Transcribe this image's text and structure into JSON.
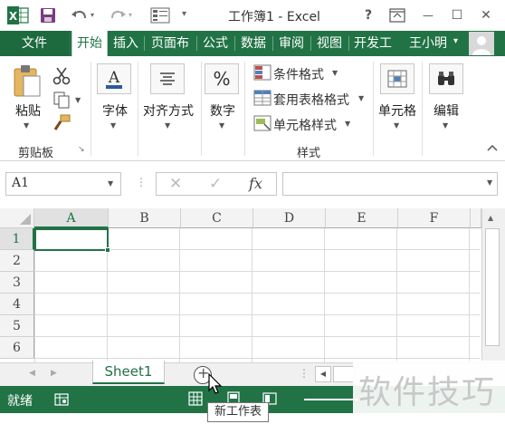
{
  "window": {
    "title": "工作簿1 - Excel",
    "controls": {
      "help": "?",
      "minimize": "—",
      "restore": "☐",
      "close": "✕",
      "ribbon_display": "⬒"
    }
  },
  "quick_access": {
    "save": "save-icon",
    "undo": "undo-icon",
    "redo": "redo-icon",
    "form": "form-icon",
    "customize": "▾"
  },
  "tabs": [
    {
      "label": "文件"
    },
    {
      "label": "开始"
    },
    {
      "label": "插入"
    },
    {
      "label": "页面布"
    },
    {
      "label": "公式"
    },
    {
      "label": "数据"
    },
    {
      "label": "审阅"
    },
    {
      "label": "视图"
    },
    {
      "label": "开发工"
    }
  ],
  "user": {
    "name": "王小明",
    "caret": "▾"
  },
  "ribbon": {
    "clipboard": {
      "paste": "粘贴",
      "group": "剪贴板"
    },
    "font": {
      "label": "字体"
    },
    "alignment": {
      "label": "对齐方式"
    },
    "number": {
      "label": "数字",
      "symbol": "%"
    },
    "styles": {
      "conditional": "条件格式",
      "table_format": "套用表格格式",
      "cell_styles": "单元格样式",
      "group": "样式"
    },
    "cells": {
      "label": "单元格"
    },
    "editing": {
      "label": "编辑"
    }
  },
  "formula_bar": {
    "name_box": "A1",
    "fx": "fx",
    "cancel": "✕",
    "enter": "✓",
    "value": ""
  },
  "grid": {
    "columns": [
      "A",
      "B",
      "C",
      "D",
      "E",
      "F"
    ],
    "rows": [
      "1",
      "2",
      "3",
      "4",
      "5",
      "6"
    ],
    "selected_cell": "A1"
  },
  "sheets": {
    "tabs": [
      {
        "name": "Sheet1"
      }
    ],
    "add_symbol": "+",
    "nav_prev": "◀",
    "nav_next": "▶"
  },
  "status": {
    "text": "就绪"
  },
  "tooltip": "新工作表",
  "watermark": "软件技巧",
  "colors": {
    "excel_green": "#217346",
    "title_bg": "#ffffff"
  }
}
